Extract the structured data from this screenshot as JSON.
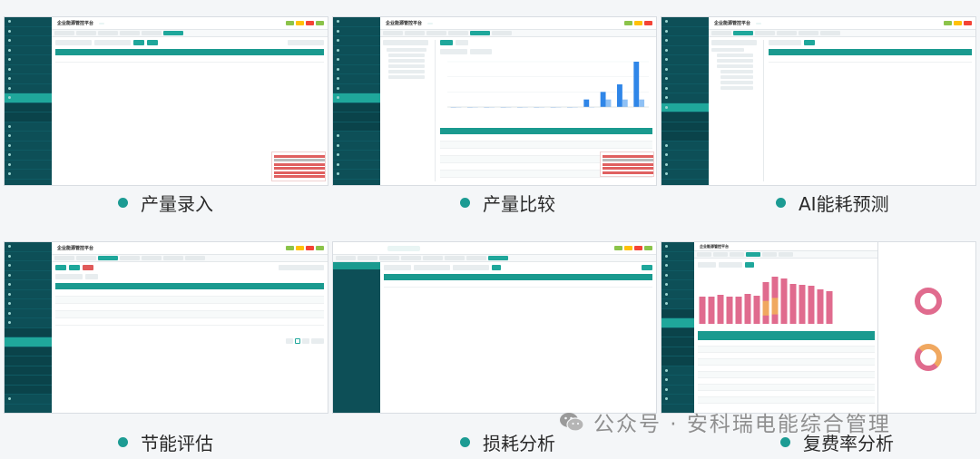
{
  "app": {
    "title": "企业能源管控平台",
    "brand_color": "#0d4f57",
    "accent_color": "#1fa79b",
    "alert_color": "#e05a5a"
  },
  "captions": [
    {
      "label": "产量录入"
    },
    {
      "label": "产量比较"
    },
    {
      "label": "AI能耗预测"
    },
    {
      "label": "节能评估"
    },
    {
      "label": "损耗分析"
    },
    {
      "label": "复费率分析"
    }
  ],
  "watermark": {
    "text": "公众号 · 安科瑞电能综合管理",
    "icon": "wechat-icon"
  },
  "bullet_color": "#1c9b93",
  "chart_data": {
    "type": "bar",
    "title": "",
    "xlabel": "",
    "ylabel": "",
    "categories": [
      "1",
      "2",
      "3",
      "4",
      "5",
      "6",
      "7",
      "8",
      "9",
      "10",
      "11",
      "12"
    ],
    "series": [
      {
        "values": [
          0,
          0,
          0,
          0,
          0,
          0,
          0,
          0,
          1,
          2,
          3,
          6
        ]
      },
      {
        "values": [
          0,
          0,
          0,
          0,
          0,
          0,
          0,
          0,
          0,
          1,
          1,
          1
        ]
      }
    ]
  }
}
